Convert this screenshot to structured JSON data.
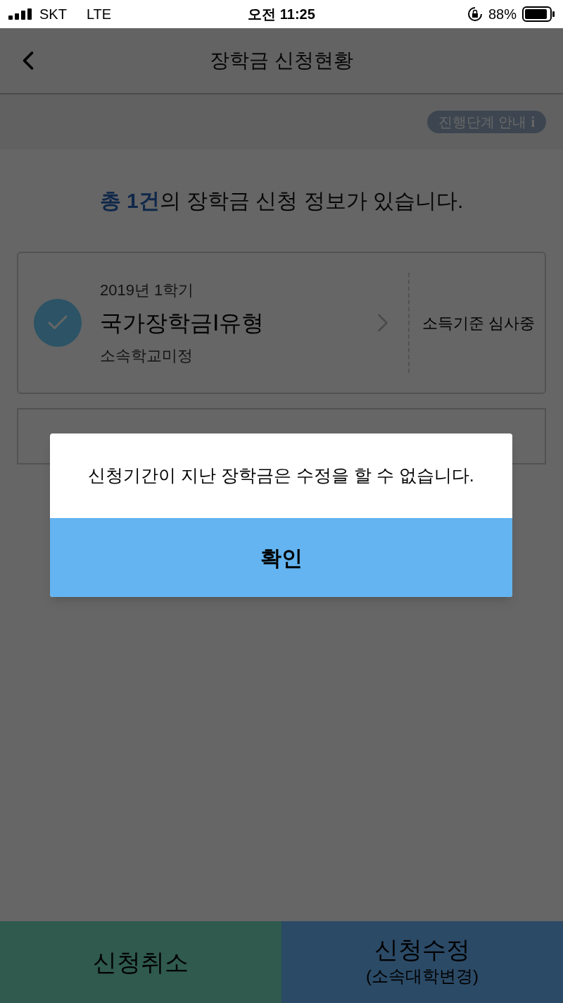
{
  "status_bar": {
    "carrier": "SKT",
    "network": "LTE",
    "time": "오전 11:25",
    "battery": "88%"
  },
  "header": {
    "title": "장학금 신청현황"
  },
  "guide_button": {
    "label": "진행단계 안내",
    "icon_text": "i"
  },
  "summary": {
    "count": "총 1건",
    "text": "의 장학금 신청 정보가 있습니다."
  },
  "applications": [
    {
      "term": "2019년 1학기",
      "name": "국가장학금Ⅰ유형",
      "school": "소속학교미정",
      "status": "소득기준 심사중",
      "checked": true
    }
  ],
  "dialog": {
    "message": "신청기간이 지난 장학금은 수정을 할 수 없습니다.",
    "button": "확인"
  },
  "bottom_buttons": [
    {
      "label": "신청취소",
      "color": "#2f5a4d"
    },
    {
      "label": "신청수정",
      "sub": "(소속대학변경)",
      "color": "#2b4a66"
    }
  ]
}
